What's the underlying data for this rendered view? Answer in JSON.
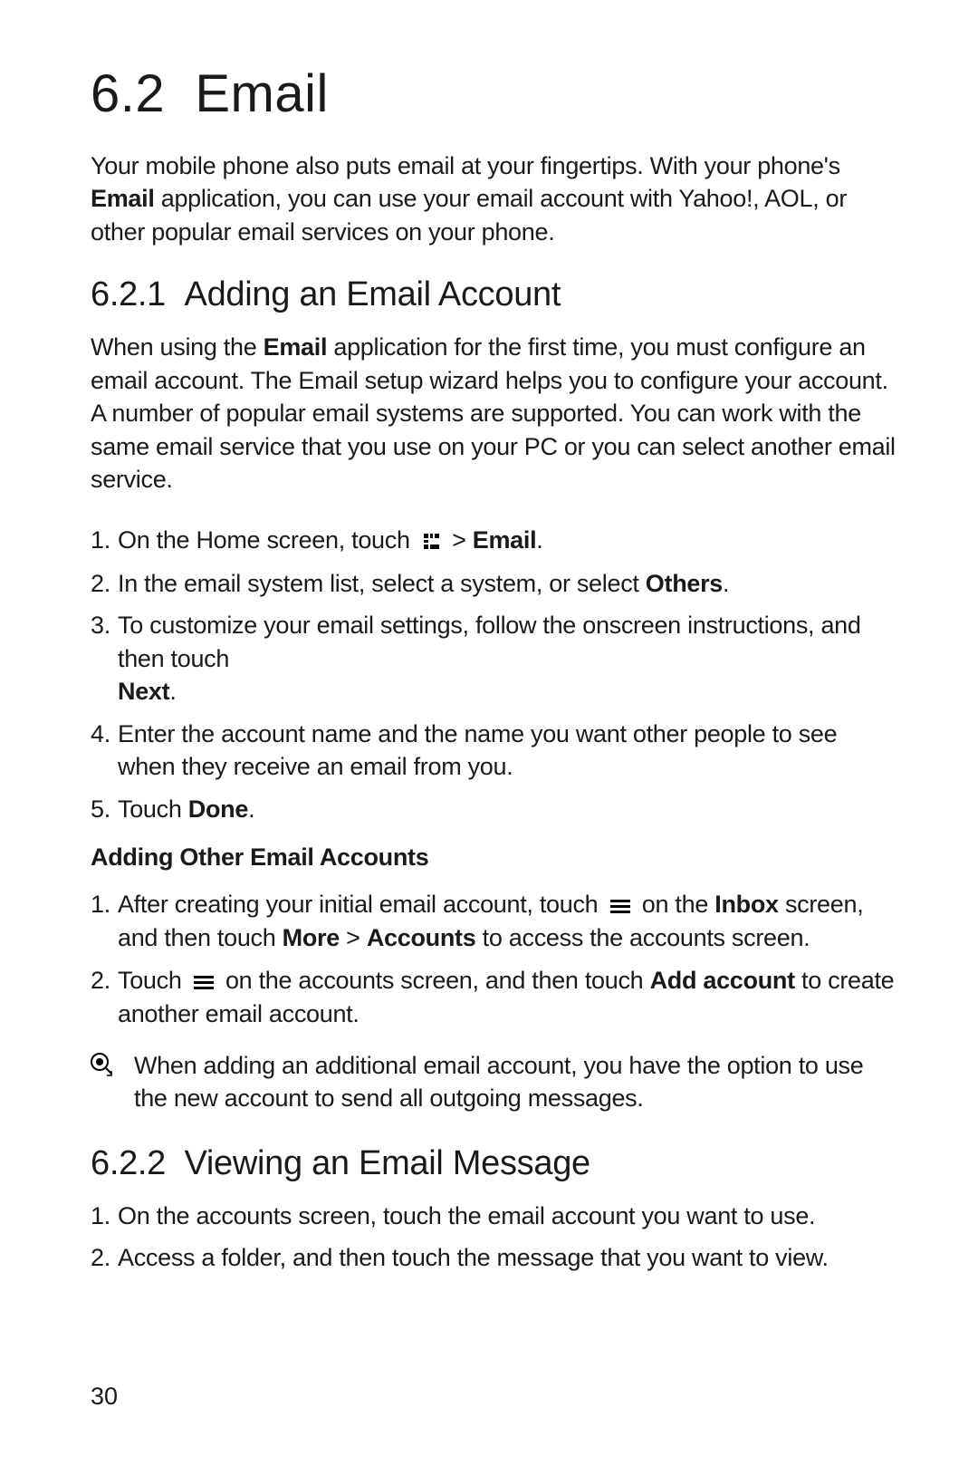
{
  "section": {
    "number": "6.2",
    "title": "Email",
    "intro_pre": "Your mobile phone also puts email at your fingertips. With your phone's ",
    "intro_bold": "Email",
    "intro_post": " application, you can use your email account with Yahoo!, AOL, or other popular email services on your phone."
  },
  "sub621": {
    "number": "6.2.1",
    "title": "Adding an Email Account",
    "intro_pre": "When using the ",
    "intro_bold": "Email",
    "intro_post": " application for the first time, you must configure an email account. The Email setup wizard helps you to configure your account. A number of popular email systems are supported. You can work with the same email service that you use on your PC or you can select another email service.",
    "steps": [
      {
        "pre": "On the Home screen, touch ",
        "icon": "apps",
        "mid": " > ",
        "bold": "Email",
        "post": "."
      },
      {
        "pre": "In the email system list, select a system, or select ",
        "bold": "Others",
        "post": "."
      },
      {
        "pre": "To customize your email settings, follow the onscreen instructions, and then touch ",
        "bold": "Next",
        "post": "."
      },
      {
        "pre": "Enter the account name and the name you want other people to see when they receive an email from you."
      },
      {
        "pre": "Touch ",
        "bold": "Done",
        "post": "."
      }
    ],
    "sub_heading": "Adding Other Email Accounts",
    "other_steps": [
      {
        "pre": "After creating your initial email account, touch ",
        "icon": "menu",
        "mid": " on the ",
        "bold": "Inbox",
        "post1": " screen, and then touch ",
        "bold2": "More",
        "sep": " > ",
        "bold3": "Accounts",
        "post2": " to access the accounts screen."
      },
      {
        "pre": "Touch ",
        "icon": "menu",
        "mid": " on the accounts screen, and then touch ",
        "bold": "Add account",
        "post": " to create another email account."
      }
    ],
    "note": "When adding an additional email account, you have the option to use the new account to send all outgoing messages."
  },
  "sub622": {
    "number": "6.2.2",
    "title": "Viewing an Email Message",
    "steps": [
      {
        "pre": "On the accounts screen, touch the email account you want to use."
      },
      {
        "pre": "Access a folder, and then touch the message that you want to view."
      }
    ]
  },
  "page_number": "30"
}
